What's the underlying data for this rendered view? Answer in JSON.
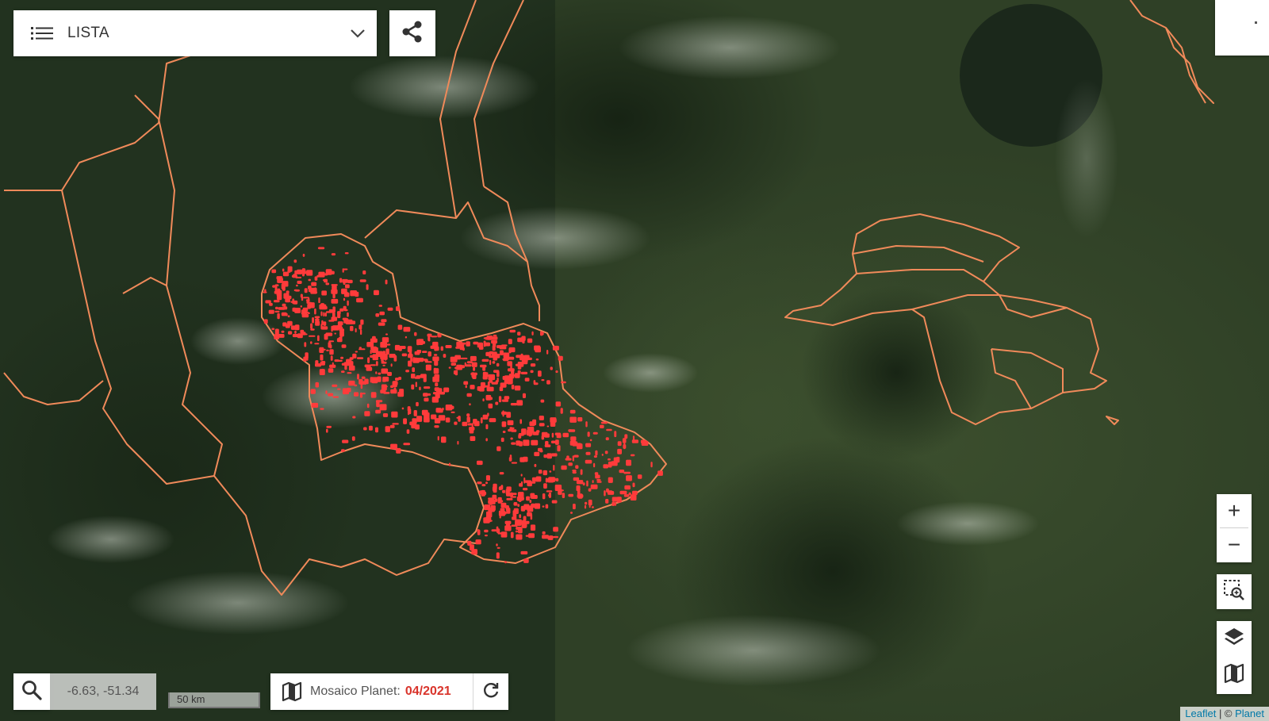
{
  "list_dropdown": {
    "label": "LISTA"
  },
  "zoom": {
    "in_label": "+",
    "out_label": "−"
  },
  "coordinates": {
    "value": "-6.63, -51.34"
  },
  "scale": {
    "label": "50 km"
  },
  "mosaic": {
    "label": "Mosaico Planet:",
    "date": "04/2021"
  },
  "attribution": {
    "leaflet": "Leaflet",
    "separator": " | © ",
    "planet": "Planet"
  },
  "colors": {
    "boundary": "#f08a5a",
    "deforestation": "#ff3b3b",
    "accent_date": "#d9342b",
    "link": "#0078a8"
  },
  "icons": {
    "list": "list-icon",
    "dropdown": "chevron-down-icon",
    "share": "share-icon",
    "zoom_area": "zoom-area-icon",
    "layers": "layers-icon",
    "map": "map-icon",
    "search": "search-icon",
    "refresh": "refresh-icon"
  }
}
